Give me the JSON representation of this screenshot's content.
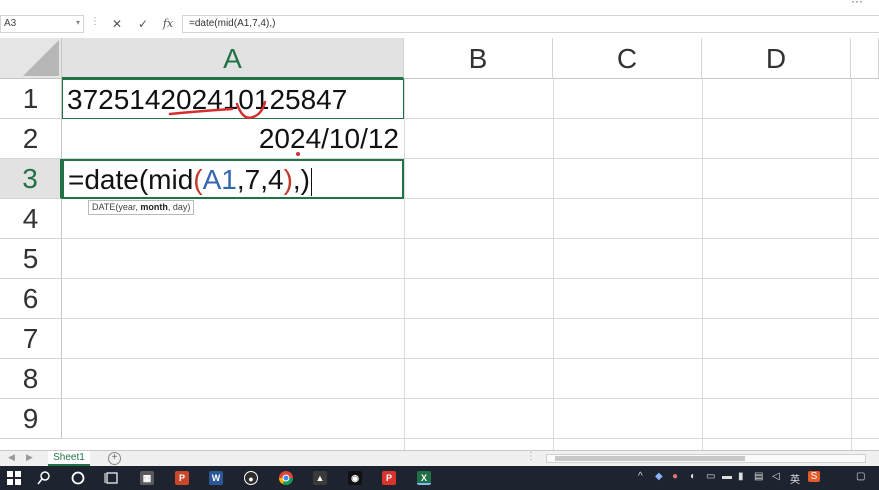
{
  "formula_bar": {
    "name_box": "A3",
    "name_box_arrow": "▾",
    "cancel_icon": "✕",
    "enter_icon": "✓",
    "fx_label": "fx",
    "formula": "=date(mid(A1,7,4),)"
  },
  "columns": [
    "A",
    "B",
    "C",
    "D"
  ],
  "rows": [
    "1",
    "2",
    "3",
    "4",
    "5",
    "6",
    "7",
    "8",
    "9"
  ],
  "selected_column": "A",
  "selected_row": "3",
  "cells": {
    "A1": "372514202410125847",
    "A2": "2024/10/12",
    "A3": {
      "part1": "=date(mid",
      "paren_open": "(",
      "ref": "A1",
      "args": ",7,4",
      "paren_close": ")",
      "tail": ",)"
    }
  },
  "tooltip": {
    "prefix": "DATE(year, ",
    "bold": "month",
    "suffix": ", day)"
  },
  "sheet_tabs": [
    "Sheet1"
  ],
  "add_sheet_icon": "+",
  "annotation_color": "#d32f2f",
  "accent_color": "#217346",
  "taskbar": {
    "ime_label": "英",
    "icons": [
      "windows-icon",
      "search-icon",
      "cortana-icon",
      "task-view-icon",
      "calculator-icon",
      "powerpoint-icon",
      "word-icon",
      "panda-icon",
      "chrome-icon",
      "photos-icon",
      "qq-icon",
      "wps-icon",
      "excel-icon"
    ]
  }
}
